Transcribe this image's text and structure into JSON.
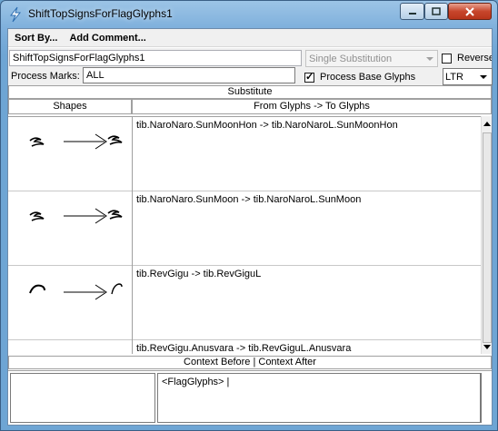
{
  "window": {
    "title": "ShiftTopSignsForFlagGlyphs1",
    "app_icon": "lightning-icon",
    "controls": {
      "minimize": "minimize-icon",
      "maximize": "maximize-icon",
      "close": "close-icon"
    }
  },
  "menu": {
    "items": [
      {
        "label": "Sort By..."
      },
      {
        "label": "Add Comment..."
      }
    ]
  },
  "toolbar": {
    "name_value": "ShiftTopSignsForFlagGlyphs1",
    "lookup_type": "Single Substitution",
    "reverse_label": "Reverse",
    "process_marks_label": "Process Marks:",
    "process_marks_value": "ALL",
    "process_base_glyphs_label": "Process Base Glyphs",
    "process_base_glyphs_checked": true,
    "direction": "LTR"
  },
  "substitute": {
    "section_title": "Substitute",
    "col_shapes": "Shapes",
    "col_glyphs": "From Glyphs -> To Glyphs",
    "rows": [
      {
        "rule": "tib.NaroNaro.SunMoonHon -> tib.NaroNaroL.SunMoonHon"
      },
      {
        "rule": "tib.NaroNaro.SunMoon -> tib.NaroNaroL.SunMoon"
      },
      {
        "rule": "tib.RevGigu -> tib.RevGiguL"
      },
      {
        "rule": "tib.RevGigu.Anusvara -> tib.RevGiguL.Anusvara"
      }
    ]
  },
  "context": {
    "section_title": "Context Before | Context After",
    "before": "",
    "after": "<FlagGlyphs> |"
  }
}
